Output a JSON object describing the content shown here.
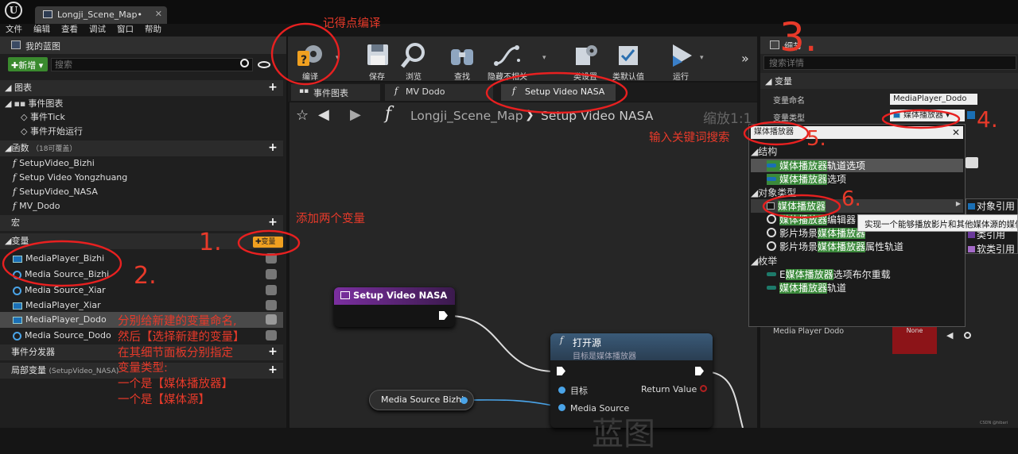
{
  "window": {
    "doc_tab": "Longji_Scene_Map•",
    "close": "✕"
  },
  "menu": [
    "文件",
    "编辑",
    "查看",
    "调试",
    "窗口",
    "帮助"
  ],
  "my_blueprint": {
    "title": "我的蓝图",
    "new_button": "新增",
    "search_placeholder": "搜索",
    "graphs_header": "图表",
    "event_graph": "事件图表",
    "events": [
      "事件Tick",
      "事件开始运行"
    ],
    "functions_header": "函数",
    "functions_override": "（18可覆盖）",
    "functions": [
      "SetupVideo_Bizhi",
      "Setup Video Yongzhuang",
      "SetupVideo_NASA",
      "MV_Dodo"
    ],
    "macros_header": "宏",
    "variables_header": "变量",
    "add_var_button": "变量",
    "variables": [
      {
        "name": "MediaPlayer_Bizhi",
        "kind": "player"
      },
      {
        "name": "Media Source_Bizhi",
        "kind": "source"
      },
      {
        "name": "Media Source_Xiar",
        "kind": "source"
      },
      {
        "name": "MediaPlayer_Xiar",
        "kind": "player"
      },
      {
        "name": "MediaPlayer_Dodo",
        "kind": "player",
        "selected": true
      },
      {
        "name": "Media Source_Dodo",
        "kind": "source"
      }
    ],
    "dispatchers_header": "事件分发器",
    "local_vars_header": "局部变量",
    "local_vars_scope": "(SetupVideo_NASA)"
  },
  "toolbar": {
    "buttons": [
      {
        "label": "编译",
        "icon": "compile-icon"
      },
      {
        "label": "保存",
        "icon": "save-icon"
      },
      {
        "label": "浏览",
        "icon": "browse-icon"
      },
      {
        "label": "查找",
        "icon": "find-icon"
      },
      {
        "label": "隐藏不相关",
        "icon": "hide-unrelated-icon"
      },
      {
        "label": "类设置",
        "icon": "class-settings-icon"
      },
      {
        "label": "类默认值",
        "icon": "class-defaults-icon"
      },
      {
        "label": "运行",
        "icon": "play-icon"
      }
    ],
    "overflow": "»"
  },
  "graph_tabs": [
    {
      "label": "事件图表"
    },
    {
      "label": "MV Dodo"
    },
    {
      "label": "Setup Video NASA"
    }
  ],
  "graph": {
    "breadcrumb_root": "Longji_Scene_Map",
    "breadcrumb_sep": "❯",
    "breadcrumb_leaf": "Setup Video NASA",
    "zoom": "缩放1:1",
    "entry_node_title": "Setup Video NASA",
    "open_node_title": "打开源",
    "open_node_subtitle": "目标是媒体播放器",
    "pin_target": "目标",
    "pin_media_source": "Media Source",
    "pin_return": "Return Value",
    "var_node": "Media Source Bizhi",
    "watermark": "蓝图"
  },
  "details": {
    "title": "细节",
    "search_placeholder": "搜索详情",
    "variable_header": "变量",
    "var_name_label": "变量命名",
    "var_name_value": "MediaPlayer_Dodo",
    "var_type_label": "变量类型",
    "var_type_value": "媒体播放器",
    "default_label": "Media Player Dodo",
    "default_value": "None"
  },
  "type_popup": {
    "search_value": "媒体播放器",
    "struct_header": "结构",
    "struct_items": [
      {
        "hl": "媒体播放器",
        "rest": "轨道选项"
      },
      {
        "hl": "媒体播放器",
        "rest": "选项"
      }
    ],
    "object_header": "对象类型",
    "object_items": [
      {
        "pre": "",
        "hl": "媒体播放器",
        "rest": ""
      },
      {
        "pre": "",
        "hl": "媒体播放器",
        "rest": "编辑器"
      },
      {
        "pre": "影片场景",
        "hl": "媒体播放器",
        "rest": ""
      },
      {
        "pre": "影片场景",
        "hl": "媒体播放器",
        "rest": "属性轨道"
      }
    ],
    "enum_header": "枚举",
    "enum_items": [
      {
        "pre": "E",
        "hl": "媒体播放器",
        "rest": "选项布尔重载"
      },
      {
        "pre": "",
        "hl": "媒体播放器",
        "rest": "轨道"
      }
    ],
    "submenu": [
      "对象引用",
      "类引用",
      "软类引用"
    ],
    "tooltip": "实现一个能够播放影片和其他媒体源的媒体"
  },
  "annotations": {
    "compile": "记得点编译",
    "add_two": "添加两个变量",
    "type_keyword": "输入关键词搜索",
    "instructions": [
      "分别给新建的变量命名,",
      "然后【选择新建的变量】",
      "在其细节面板分别指定",
      "变量类型:",
      "一个是【媒体播放器】",
      "一个是【媒体源】"
    ],
    "n1": "1.",
    "n2": "2.",
    "n3": "3.",
    "n4": "4.",
    "n5": "5.",
    "n6": "6."
  },
  "colors": {
    "annotation": "#e83a2a",
    "highlight": "#3b8a3b",
    "accent_yellow": "#f0a020"
  },
  "corner_credit": "CSDN @hibari"
}
